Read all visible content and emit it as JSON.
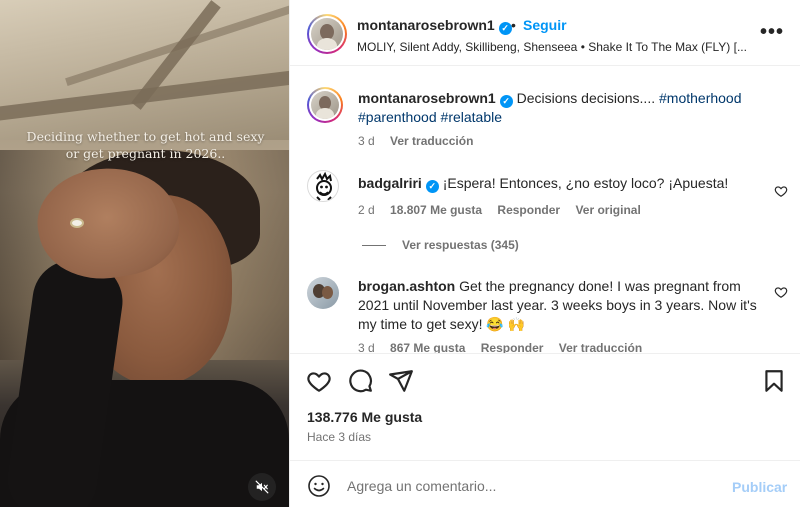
{
  "media": {
    "caption": "Deciding whether to get hot and sexy or get pregnant in 2026..",
    "mute_icon": "speaker-muted-icon"
  },
  "header": {
    "username": "montanarosebrown1",
    "verified": true,
    "separator": "•",
    "follow_label": "Seguir",
    "audio": "MOLIY, Silent Addy, Skillibeng, Shenseea • Shake It To The Max (FLY) [...",
    "more_label": "•••"
  },
  "caption_comment": {
    "username": "montanarosebrown1",
    "text": "Decisions decisions....",
    "tags": [
      "#motherhood",
      "#parenthood",
      "#relatable"
    ],
    "age": "3 d",
    "translate_label": "Ver traducción"
  },
  "comments": [
    {
      "username": "badgalriri",
      "verified": true,
      "text": "¡Espera! Entonces, ¿no estoy loco? ¡Apuesta!",
      "age": "2 d",
      "likes": "18.807 Me gusta",
      "reply_label": "Responder",
      "original_label": "Ver original",
      "replies_label": "Ver respuestas (345)"
    },
    {
      "username": "brogan.ashton",
      "verified": false,
      "text": "Get the pregnancy done! I was pregnant from 2021 until November last year. 3 weeks boys in 3 years. Now it's my time to get sexy! 😂 🙌",
      "age": "3 d",
      "likes": "867 Me gusta",
      "reply_label": "Responder",
      "translate_label": "Ver traducción"
    }
  ],
  "actions": {
    "like_icon": "heart-icon",
    "comment_icon": "comment-icon",
    "share_icon": "paper-plane-icon",
    "save_icon": "bookmark-icon"
  },
  "stats": {
    "likes": "138.776 Me gusta",
    "date": "Hace 3 días"
  },
  "add_comment": {
    "placeholder": "Agrega un comentario...",
    "post_label": "Publicar",
    "post_color": "#a4cdf8"
  },
  "colors": {
    "accent": "#0095f6",
    "hashtag": "#00376b",
    "muted": "#737373"
  }
}
